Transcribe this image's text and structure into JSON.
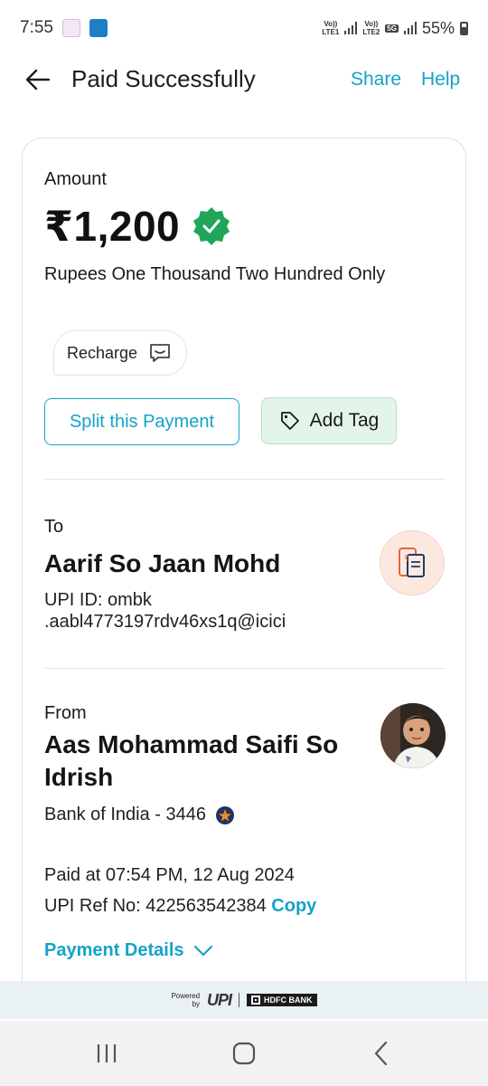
{
  "status_bar": {
    "time": "7:55",
    "sim1_label_top": "Vo))",
    "sim1_label_bottom": "LTE1",
    "sim2_label_top": "Vo))",
    "sim2_label_bottom": "LTE2",
    "network_badge": "5G",
    "battery": "55%"
  },
  "header": {
    "title": "Paid Successfully",
    "share_label": "Share",
    "help_label": "Help"
  },
  "amount": {
    "label": "Amount",
    "value": "₹1,200",
    "in_words": "Rupees One Thousand Two Hundred Only",
    "note": "Recharge"
  },
  "actions": {
    "split_label": "Split this Payment",
    "tag_label": "Add Tag"
  },
  "to": {
    "label": "To",
    "name": "Aarif So Jaan Mohd",
    "upi_line1": "UPI ID: ombk",
    "upi_line2": ".aabl4773197rdv46xs1q@icici"
  },
  "from": {
    "label": "From",
    "name_line1": "Aas Mohammad Saifi So",
    "name_line2": "Idrish",
    "bank": "Bank of India - 3446"
  },
  "transaction": {
    "paid_at": "Paid at 07:54 PM, 12 Aug 2024",
    "ref_label": "UPI Ref No: 422563542384",
    "copy_label": "Copy",
    "details_label": "Payment Details"
  },
  "footer": {
    "powered_line1": "Powered",
    "powered_line2": "by",
    "upi_logo": "UPI",
    "bank_logo": "HDFC BANK"
  },
  "colors": {
    "accent": "#14a3c7",
    "verified_green": "#1fa65a",
    "tag_bg": "#e3f5ea"
  },
  "icons": {
    "back": "arrow-left-icon",
    "verified": "verified-badge-icon",
    "note": "message-icon",
    "tag": "tag-icon",
    "receipt": "receipt-phone-icon",
    "bank": "bank-of-india-icon",
    "details": "chevron-down-icon"
  }
}
